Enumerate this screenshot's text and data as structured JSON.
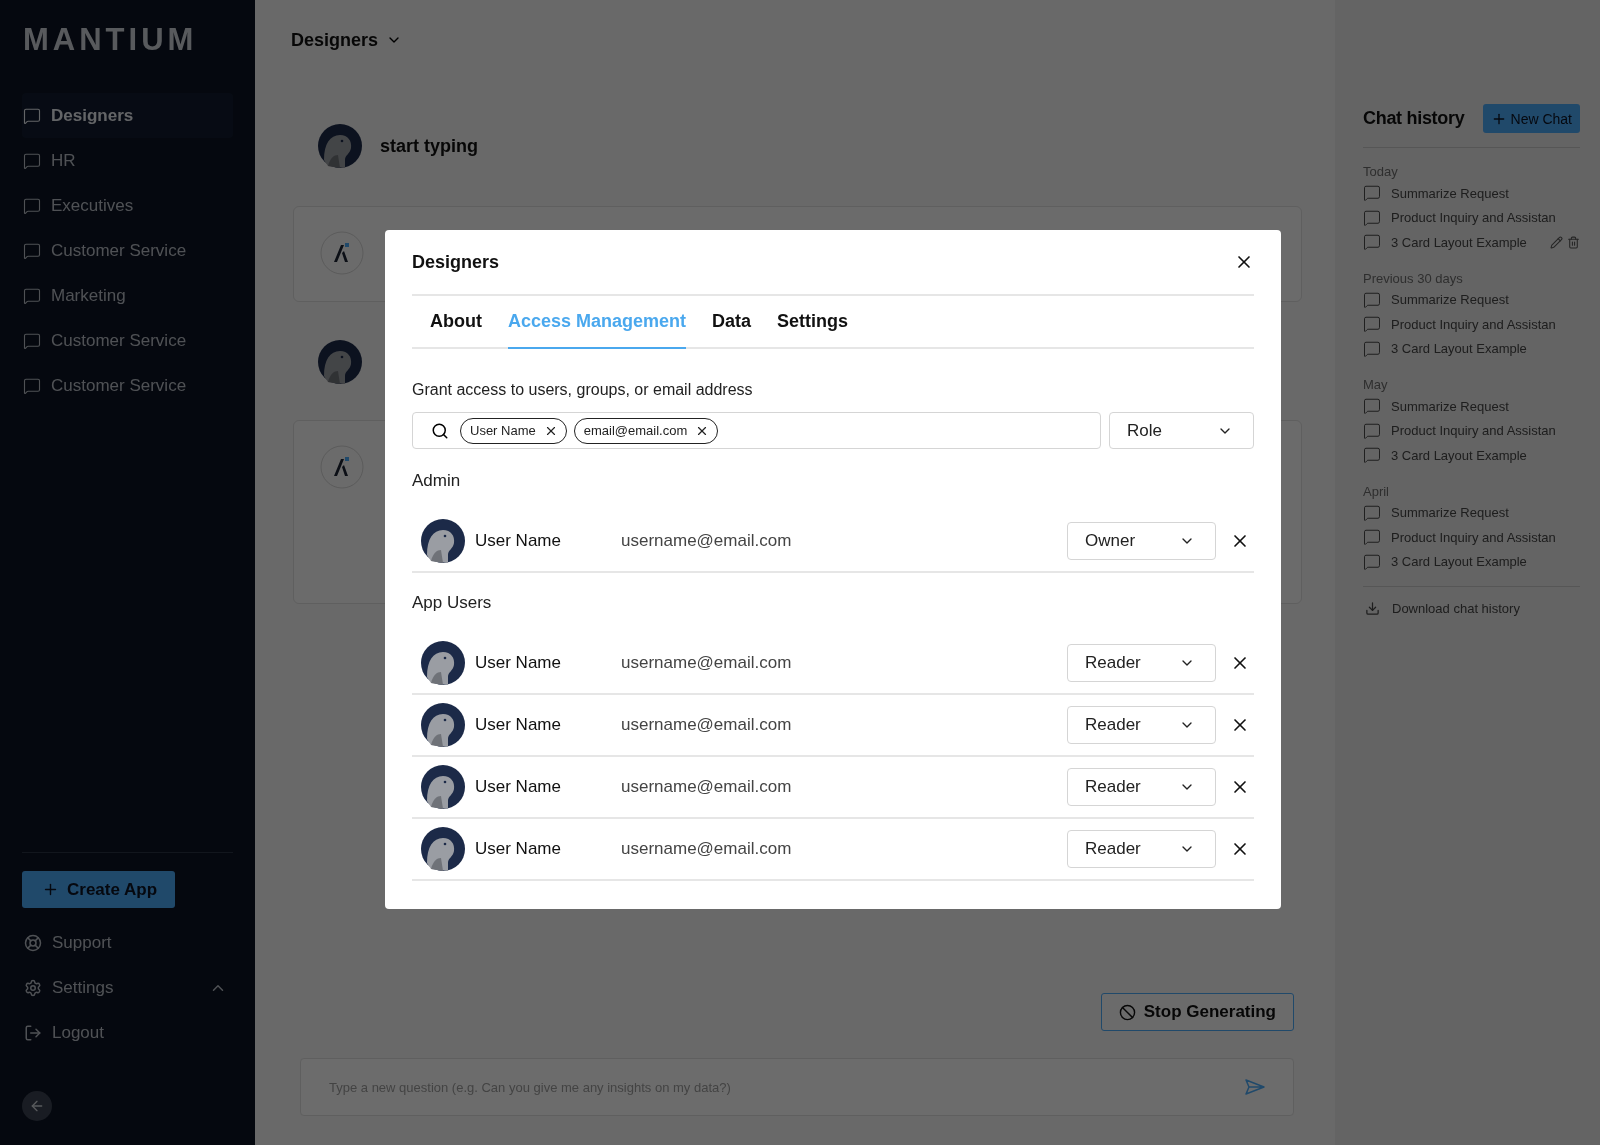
{
  "sidebar": {
    "logo": "MANTIUM",
    "items": [
      {
        "label": "Designers",
        "selected": true
      },
      {
        "label": "HR",
        "selected": false
      },
      {
        "label": "Executives",
        "selected": false
      },
      {
        "label": "Customer Service",
        "selected": false
      },
      {
        "label": "Marketing",
        "selected": false
      },
      {
        "label": "Customer Service",
        "selected": false
      },
      {
        "label": "Customer Service",
        "selected": false
      }
    ],
    "create_button": "Create App",
    "footer_items": [
      {
        "kind": "support",
        "label": "Support"
      },
      {
        "kind": "settings",
        "label": "Settings",
        "expanded": true
      },
      {
        "kind": "logout",
        "label": "Logout"
      }
    ]
  },
  "header": {
    "workspace": "Designers"
  },
  "chat": {
    "prompt": "start typing",
    "stop_button": "Stop Generating",
    "input_placeholder": "Type a new question (e.g. Can you give me any insights on my data?)"
  },
  "chat_history": {
    "title": "Chat history",
    "new_button": "New Chat",
    "groups": [
      {
        "label": "Today",
        "items": [
          {
            "title": "Summarize Request",
            "show_actions": false
          },
          {
            "title": "Product Inquiry and Assistan",
            "show_actions": false
          },
          {
            "title": "3 Card Layout Example",
            "show_actions": true
          }
        ]
      },
      {
        "label": "Previous 30 days",
        "items": [
          {
            "title": "Summarize Request",
            "show_actions": false
          },
          {
            "title": "Product Inquiry and Assistan",
            "show_actions": false
          },
          {
            "title": "3 Card Layout Example",
            "show_actions": false
          }
        ]
      },
      {
        "label": "May",
        "items": [
          {
            "title": "Summarize Request",
            "show_actions": false
          },
          {
            "title": "Product Inquiry and Assistan",
            "show_actions": false
          },
          {
            "title": "3 Card Layout Example",
            "show_actions": false
          }
        ]
      },
      {
        "label": "April",
        "items": [
          {
            "title": "Summarize Request",
            "show_actions": false
          },
          {
            "title": "Product Inquiry and Assistan",
            "show_actions": false
          },
          {
            "title": "3 Card Layout Example",
            "show_actions": false
          }
        ]
      }
    ],
    "download": "Download chat history"
  },
  "modal": {
    "title": "Designers",
    "tabs": [
      {
        "label": "About",
        "selected": false
      },
      {
        "label": "Access Management",
        "selected": true
      },
      {
        "label": "Data",
        "selected": false
      },
      {
        "label": "Settings",
        "selected": false
      }
    ],
    "grant_label": "Grant access to users, groups, or email address",
    "tokens": [
      "User Name",
      "email@email.com"
    ],
    "role_placeholder": "Role",
    "sections": [
      {
        "title": "Admin",
        "members": [
          {
            "name": "User Name",
            "email": "username@email.com",
            "role": "Owner"
          }
        ]
      },
      {
        "title": "App Users",
        "members": [
          {
            "name": "User Name",
            "email": "username@email.com",
            "role": "Reader"
          },
          {
            "name": "User Name",
            "email": "username@email.com",
            "role": "Reader"
          },
          {
            "name": "User Name",
            "email": "username@email.com",
            "role": "Reader"
          },
          {
            "name": "User Name",
            "email": "username@email.com",
            "role": "Reader"
          }
        ]
      }
    ]
  }
}
